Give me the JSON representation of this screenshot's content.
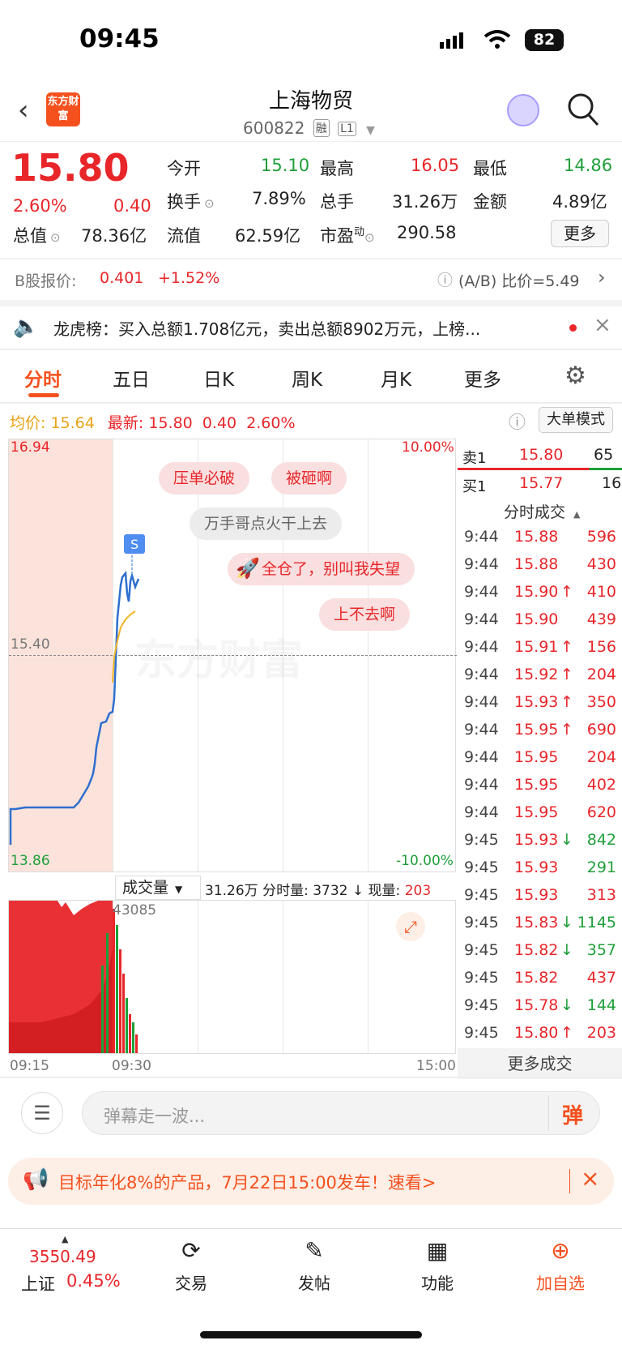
{
  "status_bar": {
    "time": "09:45",
    "battery": "82"
  },
  "header": {
    "title": "上海物贸",
    "code": "600822",
    "tags": [
      "融",
      "L1"
    ],
    "logo": "东方财富"
  },
  "quote": {
    "price": "15.80",
    "change_pct": "2.60%",
    "change": "0.40",
    "open_label": "今开",
    "open": "15.10",
    "high_label": "最高",
    "high": "16.05",
    "low_label": "最低",
    "low": "14.86",
    "turnover_label": "换手",
    "turnover": "7.89%",
    "vol_label": "总手",
    "vol": "31.26万",
    "amount_label": "金额",
    "amount": "4.89亿",
    "mktcap_label": "总值",
    "mktcap": "78.36亿",
    "float_label": "流值",
    "float": "62.59亿",
    "pe_label": "市盈",
    "pe_sup": "动",
    "pe": "290.58",
    "more": "更多"
  },
  "bshare": {
    "label": "B股报价:",
    "price": "0.401",
    "change": "+1.52%",
    "ratio": "(A/B) 比价=5.49"
  },
  "notice": {
    "text": "龙虎榜：买入总额1.708亿元，卖出总额8902万元，上榜..."
  },
  "tabs": [
    "分时",
    "五日",
    "日K",
    "周K",
    "月K",
    "更多"
  ],
  "chart_info": {
    "avg_label": "均价:",
    "avg": "15.64",
    "latest_label": "最新:",
    "latest": "15.80",
    "chg": "0.40",
    "pct": "2.60%",
    "mode": "大单模式"
  },
  "chart_axes": {
    "top": "16.94",
    "mid": "15.40",
    "bottom": "13.86",
    "top_pct": "10.00%",
    "bottom_pct": "-10.00%",
    "t_start": "09:15",
    "t_mid": "09:30",
    "t_end": "15:00"
  },
  "bubbles": [
    "压单必破",
    "被砸啊",
    "万手哥点火干上去",
    "全仓了，别叫我失望",
    "上不去啊"
  ],
  "vol_info": {
    "selector": "成交量",
    "total": "31.26万",
    "minute_label": "分时量:",
    "minute": "3732",
    "now_label": "现量:",
    "now": "203",
    "peak": "43085"
  },
  "order_book": {
    "sell_label": "卖1",
    "sell_price": "15.80",
    "sell_qty": "65",
    "buy_label": "买1",
    "buy_price": "15.77",
    "buy_qty": "16",
    "title": "分时成交"
  },
  "trades": [
    {
      "t": "9:44",
      "p": "15.88",
      "a": "",
      "q": "596",
      "c": "red"
    },
    {
      "t": "9:44",
      "p": "15.88",
      "a": "",
      "q": "430",
      "c": "red"
    },
    {
      "t": "9:44",
      "p": "15.90",
      "a": "↑",
      "q": "410",
      "c": "red"
    },
    {
      "t": "9:44",
      "p": "15.90",
      "a": "",
      "q": "439",
      "c": "red"
    },
    {
      "t": "9:44",
      "p": "15.91",
      "a": "↑",
      "q": "156",
      "c": "red"
    },
    {
      "t": "9:44",
      "p": "15.92",
      "a": "↑",
      "q": "204",
      "c": "red"
    },
    {
      "t": "9:44",
      "p": "15.93",
      "a": "↑",
      "q": "350",
      "c": "red"
    },
    {
      "t": "9:44",
      "p": "15.95",
      "a": "↑",
      "q": "690",
      "c": "red"
    },
    {
      "t": "9:44",
      "p": "15.95",
      "a": "",
      "q": "204",
      "c": "red"
    },
    {
      "t": "9:44",
      "p": "15.95",
      "a": "",
      "q": "402",
      "c": "red"
    },
    {
      "t": "9:44",
      "p": "15.95",
      "a": "",
      "q": "620",
      "c": "red"
    },
    {
      "t": "9:45",
      "p": "15.93",
      "a": "↓",
      "q": "842",
      "c": "green"
    },
    {
      "t": "9:45",
      "p": "15.93",
      "a": "",
      "q": "291",
      "c": "green"
    },
    {
      "t": "9:45",
      "p": "15.93",
      "a": "",
      "q": "313",
      "c": "red"
    },
    {
      "t": "9:45",
      "p": "15.83",
      "a": "↓",
      "q": "1145",
      "c": "green"
    },
    {
      "t": "9:45",
      "p": "15.82",
      "a": "↓",
      "q": "357",
      "c": "green"
    },
    {
      "t": "9:45",
      "p": "15.82",
      "a": "",
      "q": "437",
      "c": "red"
    },
    {
      "t": "9:45",
      "p": "15.78",
      "a": "↓",
      "q": "144",
      "c": "green"
    },
    {
      "t": "9:45",
      "p": "15.80",
      "a": "↑",
      "q": "203",
      "c": "red"
    }
  ],
  "more_trades": "更多成交",
  "danmu": {
    "placeholder": "弹幕走一波...",
    "btn": "弹"
  },
  "ad": {
    "text": "目标年化8%的产品，7月22日15:00发车！速看>"
  },
  "nav": {
    "index_value": "3550.49",
    "index_name": "上证",
    "index_pct": "0.45%",
    "items": [
      "交易",
      "发帖",
      "功能",
      "加自选"
    ]
  }
}
